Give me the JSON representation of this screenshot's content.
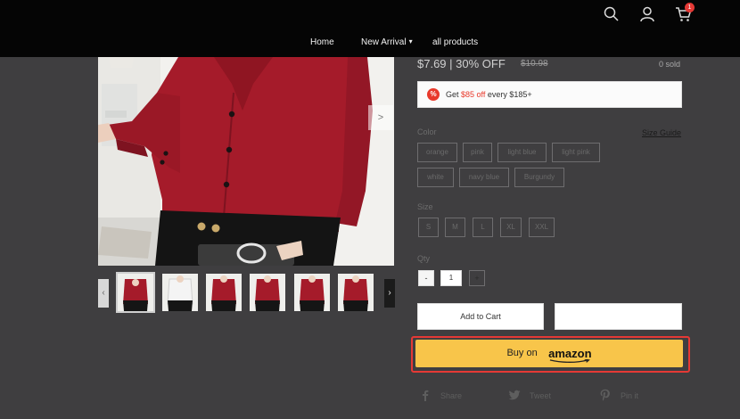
{
  "header": {
    "nav": [
      {
        "label": "Home"
      },
      {
        "label": "New Arrival"
      },
      {
        "label": "all products"
      }
    ],
    "icons": [
      "search-icon",
      "user-icon",
      "cart-icon"
    ],
    "cart_count": "1"
  },
  "product": {
    "price": "$7.69 | 30% OFF",
    "original_price": "$10.98",
    "sold": "0 sold",
    "promo": {
      "prefix": "Get ",
      "amount": "$85 off",
      "suffix": " every $185+"
    },
    "color_label": "Color",
    "size_guide": "Size Guide",
    "colors": [
      "orange",
      "pink",
      "light blue",
      "light pink",
      "white",
      "navy blue",
      "Burgundy"
    ],
    "size_label": "Size",
    "sizes": [
      "S",
      "M",
      "L",
      "XL",
      "XXL"
    ],
    "qty_label": "Qty",
    "qty_minus": "-",
    "qty_value": "1",
    "qty_plus": "+",
    "add_to_cart": "Add to Cart",
    "buy_on": "Buy on",
    "amazon": "amazon",
    "share": [
      {
        "icon": "facebook-icon",
        "label": "Share"
      },
      {
        "icon": "twitter-icon",
        "label": "Tweet"
      },
      {
        "icon": "pinterest-icon",
        "label": "Pin it"
      }
    ]
  },
  "gallery": {
    "next_arrow": ">",
    "thumb_prev": "‹",
    "thumb_next": "›",
    "thumb_count": 6,
    "active_thumb": 0
  },
  "colors": {
    "background": "#3f3e40",
    "header": "#050505",
    "accent_red": "#e8392b",
    "amazon_button": "#f8c54a",
    "shirt": "#a51b2a"
  }
}
